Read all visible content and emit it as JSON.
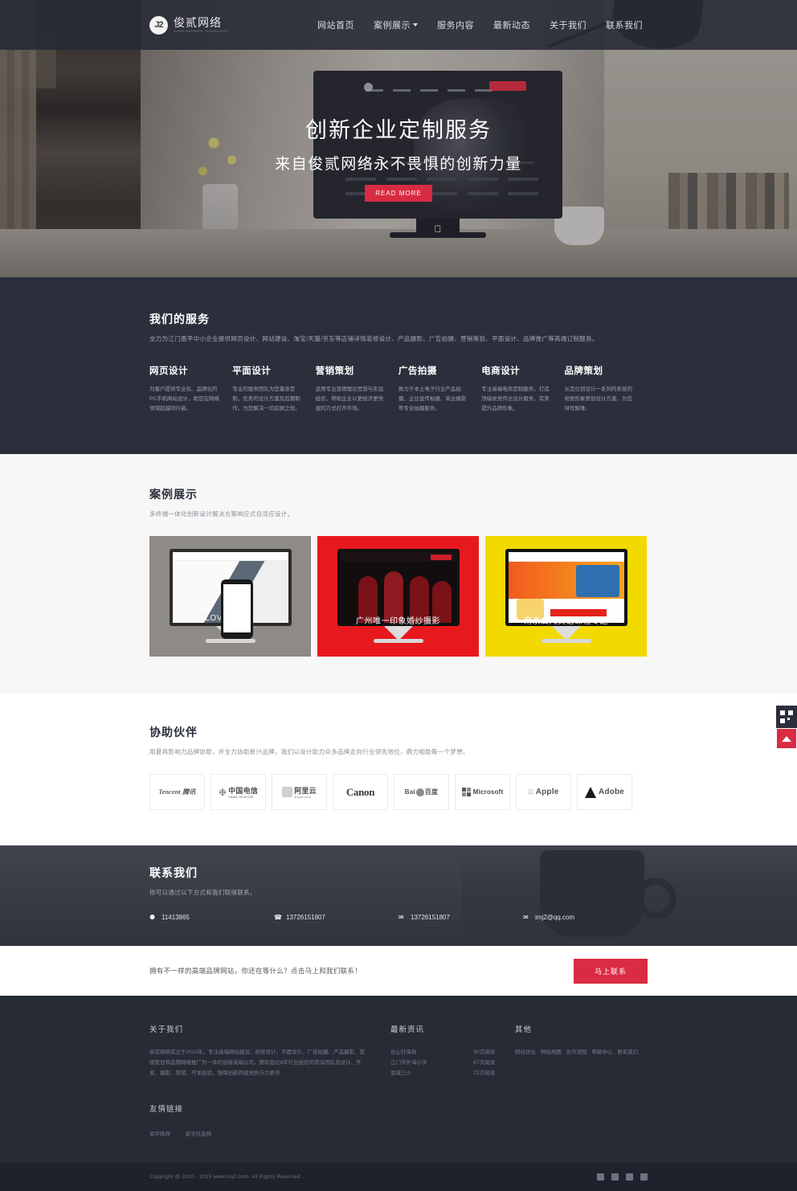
{
  "header": {
    "logo_mark": "J2",
    "logo_cn": "俊贰网络",
    "logo_en": "JUNER NETWORK TECHNOLOGY",
    "nav": [
      {
        "label": "网站首页",
        "has_dropdown": false
      },
      {
        "label": "案例展示",
        "has_dropdown": true
      },
      {
        "label": "服务内容",
        "has_dropdown": false
      },
      {
        "label": "最新动态",
        "has_dropdown": false
      },
      {
        "label": "关于我们",
        "has_dropdown": false
      },
      {
        "label": "联系我们",
        "has_dropdown": false
      }
    ]
  },
  "hero": {
    "title": "创新企业定制服务",
    "subtitle": "来自俊贰网络永不畏惧的创新力量",
    "button": "READ MORE"
  },
  "services": {
    "title": "我们的服务",
    "subtitle": "全力为江门恩平中小企业提供网页设计、网站建设、淘宝/天猫/京东等店铺详情装修设计、产品摄影、广告拍摄、营销策划、平面设计、品牌推广等高端订制服务。",
    "items": [
      {
        "title": "网页设计",
        "desc": "为客户提供专业化、品牌化的PC手机网站设计，助您在网络领域超越同行者。"
      },
      {
        "title": "平面设计",
        "desc": "专业的服务团队为您量身定制，优秀的设计方案及后期制作，为您解决一切后顾之忧。"
      },
      {
        "title": "营销策划",
        "desc": "运用专业营销理论思想与实战经验，帮助企业以更经济更快速的方式打开市场。"
      },
      {
        "title": "广告拍摄",
        "desc": "致力于本土电子行业产品拍摄、企业宣传拍摄、商业摄影等专业拍摄服务。"
      },
      {
        "title": "电商设计",
        "desc": "专注高端电商定制服务，打造顶级视觉传达设计服务，完美提升品牌形象。"
      },
      {
        "title": "品牌策划",
        "desc": "从定位到设计一系列的系统的视觉形象策划设计方案，为您排忧解难。"
      }
    ]
  },
  "cases": {
    "title": "案例展示",
    "subtitle": "多终端一体化创新设计解决方案响应式自适应设计。",
    "items": [
      {
        "title": "SOLOVE素乐",
        "accent": "#8e8b86"
      },
      {
        "title": "广州唯一印象婚纱摄影",
        "accent": "#e8191e"
      },
      {
        "title": "南京启凡英语课程专题",
        "accent": "#f2d900"
      }
    ]
  },
  "partners": {
    "title": "协助伙伴",
    "subtitle": "用最具影响力品牌协助，并全力协助新兴品牌，我们以设计助力众多品牌走向行业领先地位，鼎力相助每一个梦想。",
    "logos": [
      {
        "name": "Tencent 腾讯",
        "main": "Tencent",
        "cn": "腾讯"
      },
      {
        "name": "中国电信",
        "main": "中国电信",
        "cn": "CHINA TELECOM"
      },
      {
        "name": "阿里云",
        "main": "阿里云",
        "cn": "aliyun.com"
      },
      {
        "name": "Canon",
        "main": "Canon",
        "cn": ""
      },
      {
        "name": "百度",
        "main": "Bai",
        "cn": "百度"
      },
      {
        "name": "Microsoft",
        "main": "Microsoft",
        "cn": ""
      },
      {
        "name": "Apple",
        "main": "Apple",
        "cn": ""
      },
      {
        "name": "Adobe",
        "main": "Adobe",
        "cn": ""
      }
    ]
  },
  "contact": {
    "title": "联系我们",
    "subtitle": "你可以通过以下方式和我们取得联系。",
    "items": [
      {
        "icon": "qq-icon",
        "glyph": "⚈",
        "value": "11413865"
      },
      {
        "icon": "phone-icon",
        "glyph": "☎",
        "value": "13726151807"
      },
      {
        "icon": "wechat-icon",
        "glyph": "✉",
        "value": "13726151807"
      },
      {
        "icon": "email-icon",
        "glyph": "✉",
        "value": "imj2@qq.com"
      }
    ]
  },
  "cta": {
    "text": "拥有不一样的高端品牌网站，你还在等什么？点击马上和我们联系！",
    "button": "马上联系"
  },
  "footer": {
    "about": {
      "title": "关于我们",
      "text": "俊贰网络成立于2010年，专注高端网站建设、视觉设计、平面设计、广告拍摄、产品摄影、营销策划和品牌网络推广为一体的创新高端公司，拥有超过8年行业经验的资深团队及设计、开发、摄影、营销、开发经验，强悍创新的视觉执行力更亦"
    },
    "news": {
      "title": "最新资讯",
      "items": [
        {
          "label": "台山社保局",
          "meta": "90次阅读"
        },
        {
          "label": "江门市外海小学",
          "meta": "67次阅读"
        },
        {
          "label": "恩城三小",
          "meta": "72次阅读"
        }
      ]
    },
    "other": {
      "title": "其他",
      "links": [
        "网站优化",
        "网站地图",
        "合作流程",
        "帮助中心",
        "联系我们"
      ]
    },
    "friend": {
      "title": "友情链接",
      "links": [
        "恩平政府",
        "恩平信息网"
      ]
    },
    "copyright": "Copyright @ 2010 - 2015 www.imj2.com. All Rights Reserved .",
    "social": [
      "qq-icon",
      "weibo-icon",
      "wechat-icon",
      "email-icon"
    ]
  },
  "side_widget": {
    "qr_label": "扫描二维码",
    "back_to_top": "back-to-top"
  },
  "colors": {
    "accent_red": "#d92b42",
    "dark": "#2b2f3c",
    "footer": "#272b36"
  }
}
